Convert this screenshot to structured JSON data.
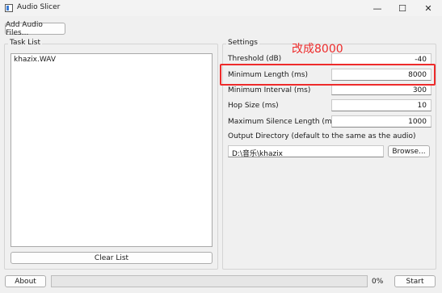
{
  "window": {
    "title": "Audio Slicer",
    "minimize_glyph": "—",
    "maximize_glyph": "☐",
    "close_glyph": "✕"
  },
  "toolbar": {
    "add_files_label": "Add Audio Files..."
  },
  "task_list": {
    "title": "Task List",
    "items": [
      "khazix.WAV"
    ],
    "clear_label": "Clear List"
  },
  "settings": {
    "title": "Settings",
    "threshold": {
      "label": "Threshold (dB)",
      "value": "-40"
    },
    "min_length": {
      "label": "Minimum Length (ms)",
      "value": "8000"
    },
    "min_interval": {
      "label": "Minimum Interval (ms)",
      "value": "300"
    },
    "hop_size": {
      "label": "Hop Size (ms)",
      "value": "10"
    },
    "max_silence": {
      "label": "Maximum Silence Length (ms)",
      "value": "1000"
    },
    "output_dir": {
      "label": "Output Directory (default to the same as the audio)",
      "value": "D:\\音乐\\khazix",
      "browse_label": "Browse..."
    }
  },
  "annotation": {
    "text": "改成8000",
    "color": "#ee2b2b"
  },
  "footer": {
    "about_label": "About",
    "progress_percent": 0,
    "progress_text": "0%",
    "start_label": "Start"
  }
}
